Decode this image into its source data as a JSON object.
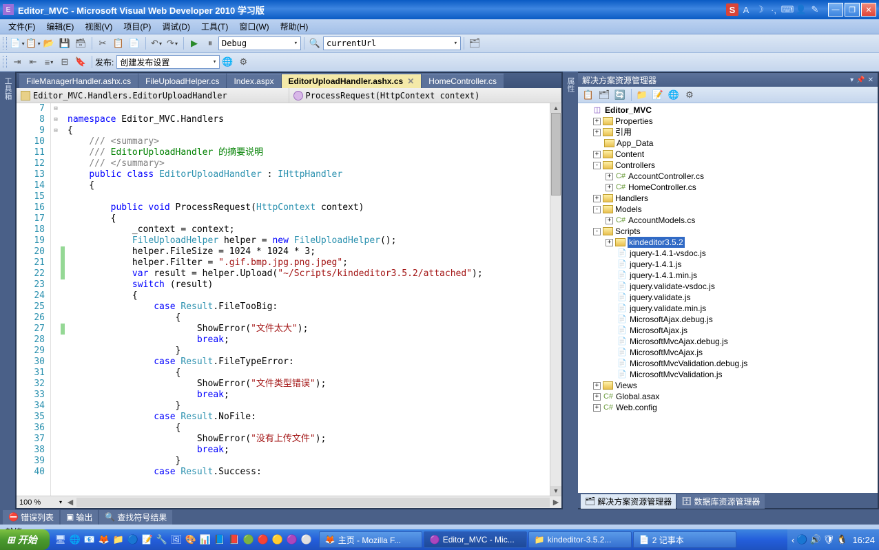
{
  "titlebar": {
    "app_icon": "E",
    "title": "Editor_MVC - Microsoft Visual Web Developer 2010 学习版",
    "tray_sogou": "S",
    "tray_items": [
      "A",
      "☽",
      "·,",
      "⌨",
      "👤",
      "✎"
    ]
  },
  "menubar": [
    "文件(F)",
    "编辑(E)",
    "视图(V)",
    "项目(P)",
    "调试(D)",
    "工具(T)",
    "窗口(W)",
    "帮助(H)"
  ],
  "toolbar1": {
    "config": "Debug",
    "search": "currentUrl"
  },
  "toolbar2": {
    "publish_label": "发布:",
    "publish_value": "创建发布设置"
  },
  "doctabs": [
    {
      "label": "FileManagerHandler.ashx.cs",
      "active": false
    },
    {
      "label": "FileUploadHelper.cs",
      "active": false
    },
    {
      "label": "Index.aspx",
      "active": false
    },
    {
      "label": "EditorUploadHandler.ashx.cs",
      "active": true
    },
    {
      "label": "HomeController.cs",
      "active": false
    }
  ],
  "navbar": {
    "class": "Editor_MVC.Handlers.EditorUploadHandler",
    "method": "ProcessRequest(HttpContext context)"
  },
  "linenums": [
    "7",
    "8",
    "9",
    "10",
    "11",
    "12",
    "13",
    "14",
    "15",
    "16",
    "17",
    "18",
    "19",
    "20",
    "21",
    "22",
    "23",
    "24",
    "25",
    "26",
    "27",
    "28",
    "29",
    "30",
    "31",
    "32",
    "33",
    "34",
    "35",
    "36",
    "37",
    "38",
    "39",
    "40"
  ],
  "folds": [
    "",
    "⊟",
    "",
    "",
    "",
    "",
    "⊟",
    "",
    "",
    "⊟",
    "",
    "",
    "",
    "",
    "",
    "",
    "",
    "",
    "",
    "",
    "",
    "",
    "",
    "",
    "",
    "",
    "",
    "",
    "",
    "",
    "",
    "",
    "",
    ""
  ],
  "marks": [
    "",
    "",
    "",
    "",
    "",
    "",
    "",
    "",
    "",
    "",
    "",
    "",
    "",
    "m",
    "m",
    "m",
    "",
    "",
    "",
    "",
    "m",
    "",
    "",
    "",
    "",
    "",
    "",
    "",
    "",
    "",
    "",
    "",
    "",
    ""
  ],
  "zoom": "100 %",
  "solution": {
    "title": "解决方案资源管理器",
    "tabs": {
      "sol": "解决方案资源管理器",
      "db": "数据库资源管理器"
    }
  },
  "tree": [
    {
      "d": 0,
      "exp": "",
      "ico": "proj",
      "label": "Editor_MVC",
      "bold": true
    },
    {
      "d": 1,
      "exp": "+",
      "ico": "fold",
      "label": "Properties"
    },
    {
      "d": 1,
      "exp": "+",
      "ico": "fold",
      "label": "引用"
    },
    {
      "d": 1,
      "exp": "",
      "ico": "fold",
      "label": "App_Data"
    },
    {
      "d": 1,
      "exp": "+",
      "ico": "fold",
      "label": "Content"
    },
    {
      "d": 1,
      "exp": "-",
      "ico": "fold-open",
      "label": "Controllers"
    },
    {
      "d": 2,
      "exp": "+",
      "ico": "cs",
      "label": "AccountController.cs"
    },
    {
      "d": 2,
      "exp": "+",
      "ico": "cs",
      "label": "HomeController.cs"
    },
    {
      "d": 1,
      "exp": "+",
      "ico": "fold",
      "label": "Handlers"
    },
    {
      "d": 1,
      "exp": "-",
      "ico": "fold-open",
      "label": "Models"
    },
    {
      "d": 2,
      "exp": "+",
      "ico": "cs",
      "label": "AccountModels.cs"
    },
    {
      "d": 1,
      "exp": "-",
      "ico": "fold-open",
      "label": "Scripts"
    },
    {
      "d": 2,
      "exp": "+",
      "ico": "fold",
      "label": "kindeditor3.5.2",
      "sel": true
    },
    {
      "d": 2,
      "exp": "",
      "ico": "js",
      "label": "jquery-1.4.1-vsdoc.js"
    },
    {
      "d": 2,
      "exp": "",
      "ico": "js",
      "label": "jquery-1.4.1.js"
    },
    {
      "d": 2,
      "exp": "",
      "ico": "js",
      "label": "jquery-1.4.1.min.js"
    },
    {
      "d": 2,
      "exp": "",
      "ico": "js",
      "label": "jquery.validate-vsdoc.js"
    },
    {
      "d": 2,
      "exp": "",
      "ico": "js",
      "label": "jquery.validate.js"
    },
    {
      "d": 2,
      "exp": "",
      "ico": "js",
      "label": "jquery.validate.min.js"
    },
    {
      "d": 2,
      "exp": "",
      "ico": "js",
      "label": "MicrosoftAjax.debug.js"
    },
    {
      "d": 2,
      "exp": "",
      "ico": "js",
      "label": "MicrosoftAjax.js"
    },
    {
      "d": 2,
      "exp": "",
      "ico": "js",
      "label": "MicrosoftMvcAjax.debug.js"
    },
    {
      "d": 2,
      "exp": "",
      "ico": "js",
      "label": "MicrosoftMvcAjax.js"
    },
    {
      "d": 2,
      "exp": "",
      "ico": "js",
      "label": "MicrosoftMvcValidation.debug.js"
    },
    {
      "d": 2,
      "exp": "",
      "ico": "js",
      "label": "MicrosoftMvcValidation.js"
    },
    {
      "d": 1,
      "exp": "+",
      "ico": "fold",
      "label": "Views"
    },
    {
      "d": 1,
      "exp": "+",
      "ico": "cs",
      "label": "Global.asax"
    },
    {
      "d": 1,
      "exp": "+",
      "ico": "cs",
      "label": "Web.config"
    }
  ],
  "bottom_tabs": [
    "错误列表",
    "输出",
    "查找符号结果"
  ],
  "status": "就绪",
  "taskbar": {
    "start": "开始",
    "tasks": [
      {
        "ico": "🦊",
        "label": "主页 - Mozilla F..."
      },
      {
        "ico": "🟣",
        "label": "Editor_MVC - Mic...",
        "active": true
      },
      {
        "ico": "📁",
        "label": "kindeditor-3.5.2..."
      },
      {
        "ico": "📄",
        "label": "2 记事本"
      }
    ],
    "clock": "16:24"
  }
}
